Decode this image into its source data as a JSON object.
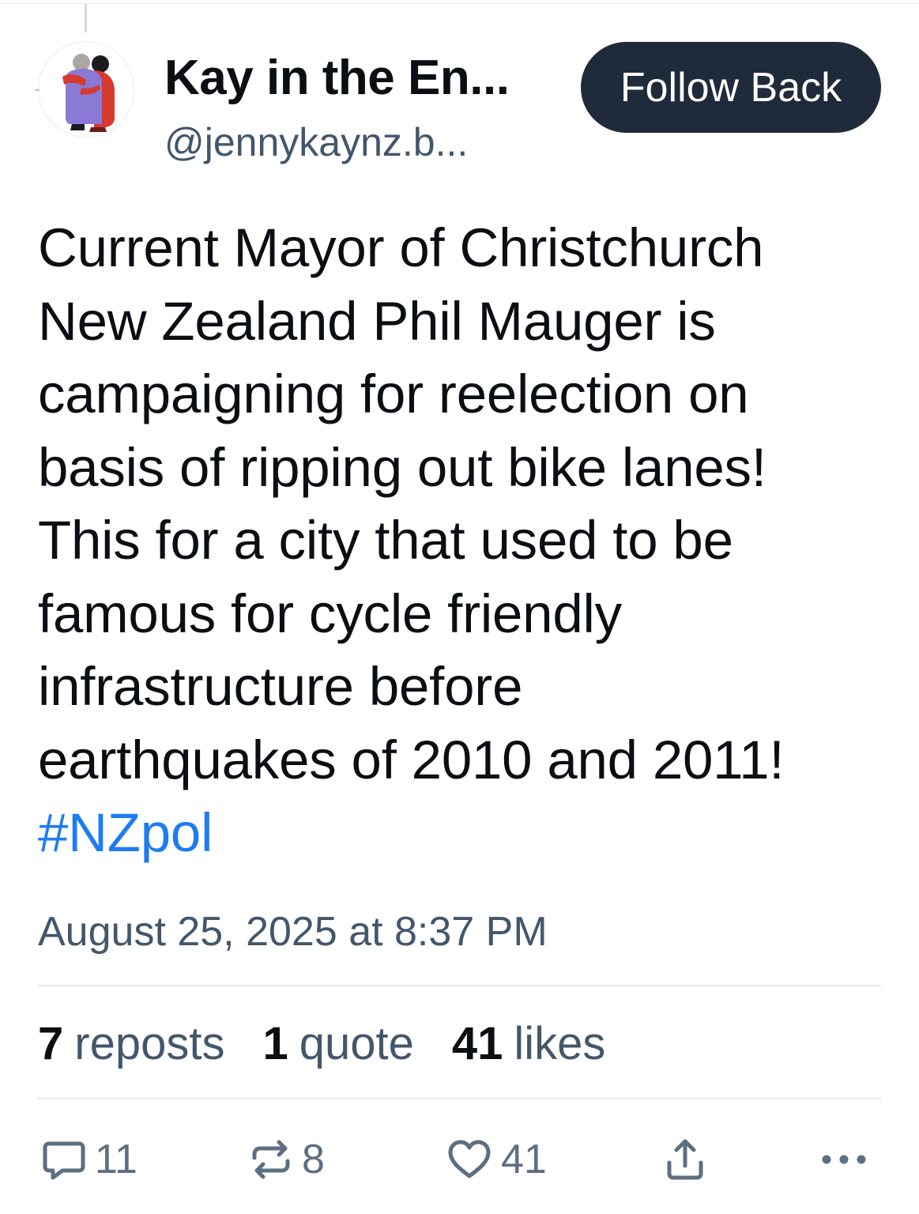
{
  "post": {
    "author_name": "Kay in the En...",
    "author_handle": "@jennykaynz.b...",
    "follow_label": "Follow Back",
    "text_lines": [
      "Current Mayor of Christchurch",
      "New Zealand Phil Mauger is",
      "campaigning for reelection on",
      "basis of ripping out bike lanes!",
      "This for a city that used to be",
      "famous for cycle friendly",
      "infrastructure before",
      "earthquakes of 2010 and 2011!"
    ],
    "hashtag": "#NZpol",
    "timestamp": "August 25, 2025 at 8:37 PM"
  },
  "stats": {
    "reposts_count": "7",
    "reposts_label": "reposts",
    "quotes_count": "1",
    "quotes_label": "quote",
    "likes_count": "41",
    "likes_label": "likes"
  },
  "actions": {
    "reply_count": "11",
    "repost_count": "8",
    "like_count": "41",
    "icons": [
      "reply-icon",
      "repost-icon",
      "heart-icon",
      "share-icon",
      "more-icon"
    ]
  },
  "colors": {
    "text": "#0b0f14",
    "muted": "#42576c",
    "link": "#1e7cf1",
    "button": "#1f2b3a"
  }
}
